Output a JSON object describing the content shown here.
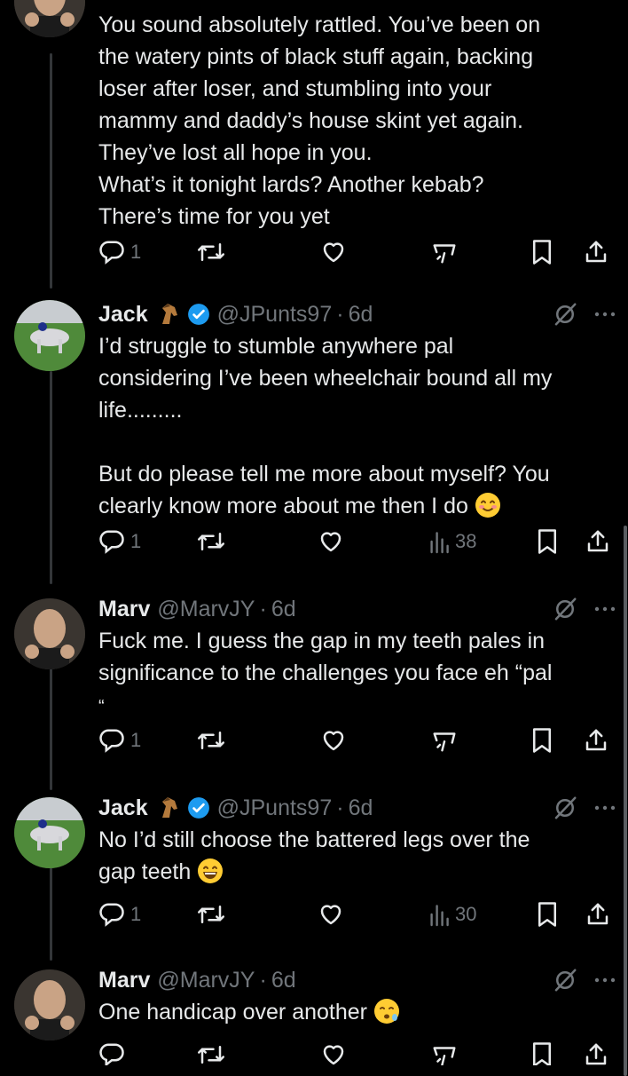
{
  "tweets": [
    {
      "lines": [
        "You sound absolutely rattled. You’ve been on",
        "the watery pints of black stuff again, backing",
        "loser after loser, and stumbling into your",
        "mammy and daddy’s house skint yet again.",
        "They’ve lost all hope in you.",
        "What’s it tonight lards? Another kebab?",
        "There’s time for you yet"
      ],
      "reply_count": "1"
    },
    {
      "name": "Jack",
      "handle": "@JPunts97",
      "dot": "·",
      "time": "6d",
      "lines": [
        "I’d struggle to stumble anywhere pal",
        "considering I’ve been wheelchair bound all my",
        "life.........",
        "",
        "But do please tell me more about myself? You",
        "clearly know more about me then I do"
      ],
      "emoji": "smiling-face-with-smiling-eyes",
      "reply_count": "1",
      "view_count": "38"
    },
    {
      "name": "Marv",
      "handle": "@MarvJY",
      "dot": "·",
      "time": "6d",
      "lines": [
        "Fuck me. I guess the gap in my teeth pales in",
        "significance to the challenges you face eh “pal",
        "“"
      ],
      "reply_count": "1"
    },
    {
      "name": "Jack",
      "handle": "@JPunts97",
      "dot": "·",
      "time": "6d",
      "lines": [
        "No I’d still choose the battered legs over the",
        "gap teeth"
      ],
      "emoji": "grinning-face-with-smiling-eyes",
      "reply_count": "1",
      "view_count": "30"
    },
    {
      "name": "Marv",
      "handle": "@MarvJY",
      "dot": "·",
      "time": "6d",
      "lines": [
        "One handicap over another"
      ],
      "emoji": "face-with-open-mouth-and-cold-sweat"
    }
  ],
  "icons": {
    "reply": "reply-icon",
    "retweet": "retweet-icon",
    "like": "heart-icon",
    "analytics": "analytics-icon",
    "views": "views-bar-chart-icon",
    "bookmark": "bookmark-icon",
    "share": "share-icon",
    "grok": "grok-icon",
    "more": "more-icon",
    "verified": "verified-badge-icon",
    "horse": "horse-face-icon"
  },
  "colors": {
    "background": "#000000",
    "text": "#e7e9ea",
    "muted": "#71767b",
    "verified": "#1d9bf0",
    "thread_line": "#333639"
  }
}
